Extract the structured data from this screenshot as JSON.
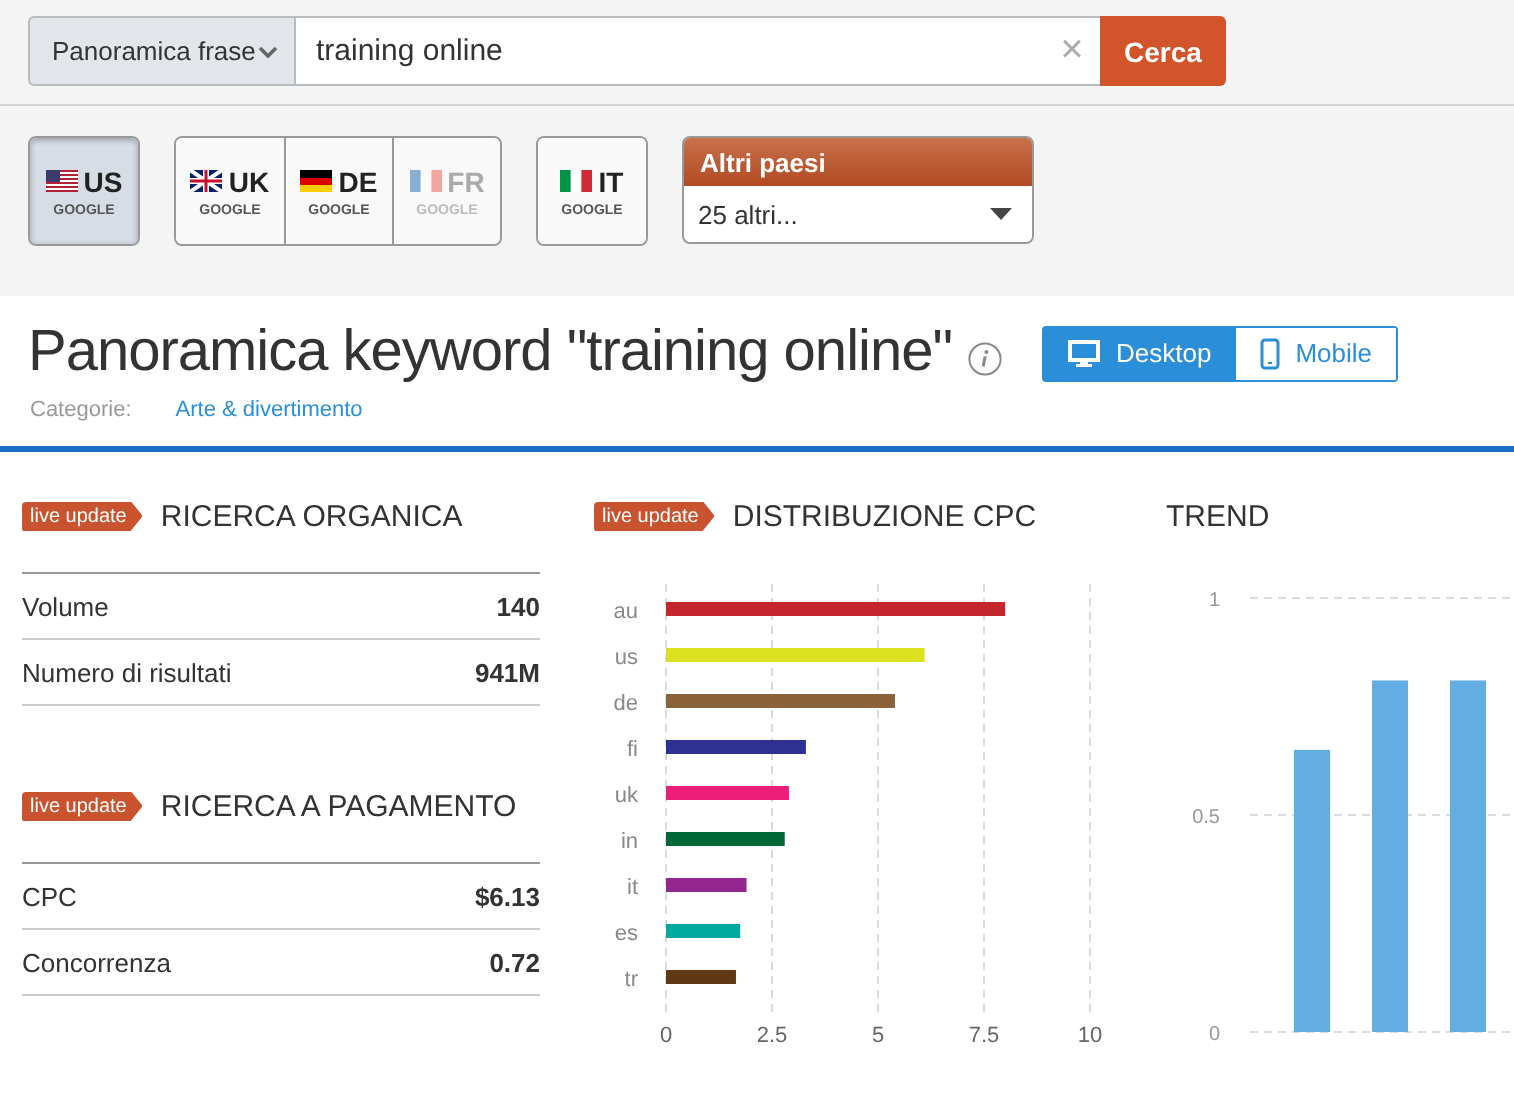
{
  "search": {
    "mode": "Panoramica frase",
    "query": "training online",
    "clear": "×",
    "submit": "Cerca"
  },
  "countries": {
    "groups": [
      [
        {
          "code": "US",
          "engine": "GOOGLE",
          "kind": "us",
          "selected": true,
          "disabled": false
        }
      ],
      [
        {
          "code": "UK",
          "engine": "GOOGLE",
          "kind": "uk",
          "selected": false,
          "disabled": false
        },
        {
          "code": "DE",
          "engine": "GOOGLE",
          "kind": "de",
          "selected": false,
          "disabled": false
        },
        {
          "code": "FR",
          "engine": "GOOGLE",
          "kind": "fr",
          "selected": false,
          "disabled": true
        }
      ],
      [
        {
          "code": "IT",
          "engine": "GOOGLE",
          "kind": "it",
          "selected": false,
          "disabled": false
        }
      ]
    ],
    "more": {
      "title": "Altri paesi",
      "value": "25 altri..."
    }
  },
  "page": {
    "title": "Panoramica keyword \"training online\"",
    "category_label": "Categorie:",
    "category": "Arte & divertimento"
  },
  "devices": [
    {
      "label": "Desktop",
      "kind": "desktop",
      "selected": true
    },
    {
      "label": "Mobile",
      "kind": "mobile",
      "selected": false
    }
  ],
  "sections": [
    {
      "badge": "live update",
      "title": "RICERCA ORGANICA",
      "rows": [
        {
          "label": "Volume",
          "value": "140"
        },
        {
          "label": "Numero di risultati",
          "value": "941M"
        }
      ]
    },
    {
      "badge": "live update",
      "title": "RICERCA A PAGAMENTO",
      "rows": [
        {
          "label": "CPC",
          "value": "$6.13"
        },
        {
          "label": "Concorrenza",
          "value": "0.72"
        }
      ]
    }
  ],
  "cpc": {
    "badge": "live update",
    "title": "DISTRIBUZIONE CPC",
    "chart_data": {
      "type": "bar",
      "orientation": "horizontal",
      "grid": true,
      "series": [
        {
          "name": "au",
          "color": "#c4262e",
          "values": [
            8.0
          ]
        },
        {
          "name": "us",
          "color": "#dbe021",
          "values": [
            6.1
          ]
        },
        {
          "name": "de",
          "color": "#8c6239",
          "values": [
            5.4
          ]
        },
        {
          "name": "fi",
          "color": "#2e3192",
          "values": [
            3.3
          ]
        },
        {
          "name": "uk",
          "color": "#ed1e79",
          "values": [
            2.9
          ]
        },
        {
          "name": "in",
          "color": "#006837",
          "values": [
            2.8
          ]
        },
        {
          "name": "it",
          "color": "#93278f",
          "values": [
            1.9
          ]
        },
        {
          "name": "es",
          "color": "#00a99d",
          "values": [
            1.75
          ]
        },
        {
          "name": "tr",
          "color": "#603813",
          "values": [
            1.65
          ]
        }
      ],
      "xlim": [
        0,
        10
      ],
      "xticks": [
        0,
        {
          "value": 2.5,
          "label": "2.5"
        },
        5,
        {
          "value": 7.5,
          "label": "7.5"
        },
        10
      ]
    }
  },
  "trend": {
    "title": "TREND",
    "chart_data": {
      "type": "bar",
      "grid": true,
      "values": [
        0.65,
        0.81,
        0.81
      ],
      "color": "#62ade1",
      "ylim": [
        0,
        1
      ],
      "yticks": [
        0,
        {
          "value": 0.5,
          "label": "0.5"
        },
        1
      ]
    }
  }
}
